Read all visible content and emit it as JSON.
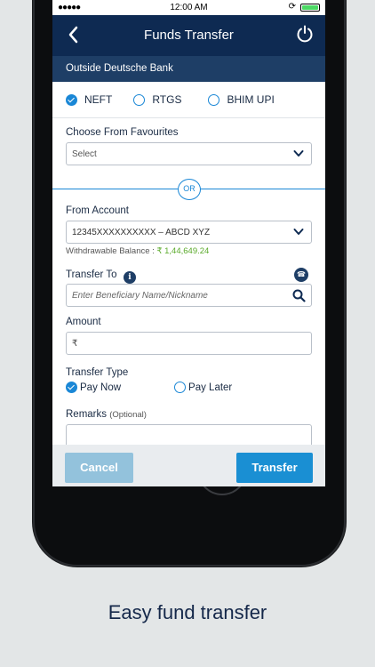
{
  "status_bar": {
    "signal": "●●●●●",
    "time": "12:00 AM"
  },
  "header": {
    "title": "Funds Transfer"
  },
  "subheader": {
    "text": "Outside Deutsche Bank"
  },
  "tabs": [
    {
      "label": "NEFT",
      "selected": true
    },
    {
      "label": "RTGS",
      "selected": false
    },
    {
      "label": "BHIM UPI",
      "selected": false
    }
  ],
  "favourites": {
    "label": "Choose From Favourites",
    "value": "Select"
  },
  "or_text": "OR",
  "from_account": {
    "label": "From Account",
    "value": "12345XXXXXXXXXX – ABCD XYZ",
    "balance_label": "Withdrawable Balance :",
    "balance_amount": "₹ 1,44,649.24"
  },
  "transfer_to": {
    "label": "Transfer To",
    "placeholder": "Enter Beneficiary Name/Nickname"
  },
  "amount": {
    "label": "Amount",
    "currency_symbol": "₹"
  },
  "transfer_type": {
    "label": "Transfer Type",
    "options": [
      {
        "label": "Pay Now",
        "selected": true
      },
      {
        "label": "Pay Later",
        "selected": false
      }
    ]
  },
  "remarks": {
    "label": "Remarks",
    "optional_text": "(Optional)"
  },
  "buttons": {
    "cancel": "Cancel",
    "transfer": "Transfer"
  },
  "caption": "Easy fund transfer",
  "colors": {
    "header": "#0e2a52",
    "subheader": "#1e3e66",
    "accent": "#1a87d6",
    "balance": "#5aaa2a"
  }
}
